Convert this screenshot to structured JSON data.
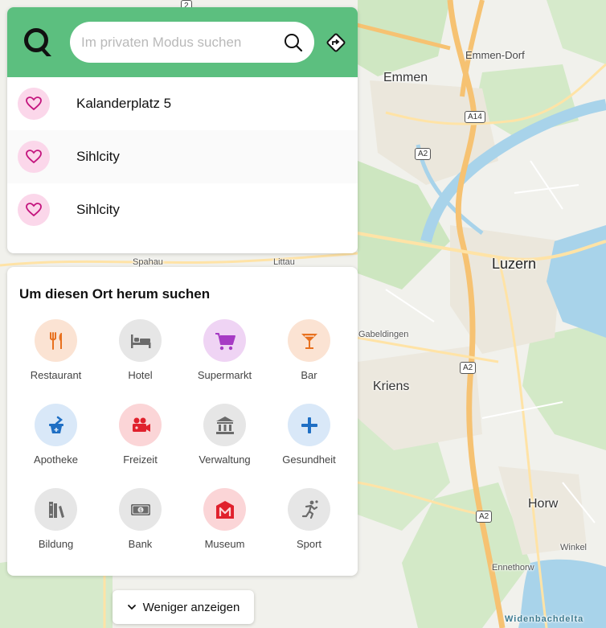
{
  "search": {
    "placeholder": "Im privaten Modus suchen"
  },
  "favorites": [
    {
      "label": "Kalanderplatz 5"
    },
    {
      "label": "Sihlcity"
    },
    {
      "label": "Sihlcity"
    }
  ],
  "categories_panel": {
    "title": "Um diesen Ort herum suchen",
    "items": [
      {
        "label": "Restaurant",
        "icon": "fork-knife-icon",
        "color": "#e8711f",
        "bg": "#fbe3d3"
      },
      {
        "label": "Hotel",
        "icon": "bed-icon",
        "color": "#6b6b6b",
        "bg": "#e6e6e6"
      },
      {
        "label": "Supermarkt",
        "icon": "cart-icon",
        "color": "#a63bc4",
        "bg": "#efd4f4"
      },
      {
        "label": "Bar",
        "icon": "cocktail-icon",
        "color": "#e8711f",
        "bg": "#fbe3d3"
      },
      {
        "label": "Apotheke",
        "icon": "mortar-pestle-icon",
        "color": "#1f6fc4",
        "bg": "#d9e8f8"
      },
      {
        "label": "Freizeit",
        "icon": "camera-icon",
        "color": "#e0212d",
        "bg": "#fbd5d7"
      },
      {
        "label": "Verwaltung",
        "icon": "government-building-icon",
        "color": "#6b6b6b",
        "bg": "#e6e6e6"
      },
      {
        "label": "Gesundheit",
        "icon": "plus-icon",
        "color": "#1f6fc4",
        "bg": "#d9e8f8"
      },
      {
        "label": "Bildung",
        "icon": "books-icon",
        "color": "#6b6b6b",
        "bg": "#e6e6e6"
      },
      {
        "label": "Bank",
        "icon": "banknote-icon",
        "color": "#6b6b6b",
        "bg": "#e6e6e6"
      },
      {
        "label": "Museum",
        "icon": "museum-icon",
        "color": "#e0212d",
        "bg": "#fbd5d7"
      },
      {
        "label": "Sport",
        "icon": "runner-icon",
        "color": "#6b6b6b",
        "bg": "#e6e6e6"
      }
    ]
  },
  "less_button": {
    "label": "Weniger anzeigen"
  },
  "map": {
    "labels": {
      "emmen": "Emmen",
      "emmen_dorf": "Emmen-Dorf",
      "luzern": "Luzern",
      "kriens": "Kriens",
      "horw": "Horw",
      "winkel": "Winkel",
      "ennethorw": "Ennethorw",
      "gabeldingen": "Gabeldingen",
      "spahau": "Spahau",
      "littau": "Littau",
      "widenbachdelta": "Widenbachdelta"
    },
    "shields": {
      "a14": "A14",
      "a2_1": "A2",
      "a2_2": "A2",
      "a2_3": "A2",
      "route_2": "2"
    },
    "colors": {
      "accent_green": "#5cbf7f",
      "water": "#a8d3ea",
      "forest": "#cde6c0",
      "motorway": "#f6c272"
    }
  }
}
